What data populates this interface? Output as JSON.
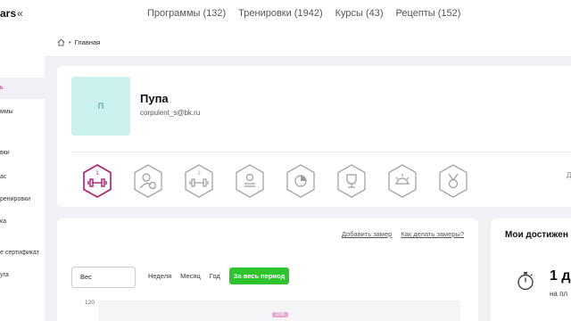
{
  "brand": {
    "logo_text": "ars",
    "collapse_icon": "double-chevron-left-icon"
  },
  "topnav": {
    "items": [
      "Программы (132)",
      "Тренировки (1942)",
      "Курсы (43)",
      "Рецепты (152)"
    ]
  },
  "sidebar": {
    "items": [
      {
        "label": "ь",
        "active": true
      },
      {
        "label": "ммы"
      },
      {
        "label": "вки"
      },
      {
        "label": "ас"
      },
      {
        "label": "ренировки"
      },
      {
        "label": "ка"
      },
      {
        "label": "е сертификат"
      },
      {
        "label": "уга"
      }
    ]
  },
  "breadcrumb": {
    "home_icon": "home-icon",
    "current": "Главная"
  },
  "profile": {
    "avatar_letter": "П",
    "name": "Пупа",
    "email": "corpulent_s@bk.ru",
    "badges": [
      {
        "icon": "dumbbell-icon",
        "number": "1",
        "active": true,
        "color": "#b2186e"
      },
      {
        "icon": "user-clock-icon",
        "active": false
      },
      {
        "icon": "dumbbell-icon",
        "number": "2",
        "active": false
      },
      {
        "icon": "id-card-icon",
        "active": false
      },
      {
        "icon": "pie-chart-icon",
        "active": false
      },
      {
        "icon": "trophy-icon",
        "active": false
      },
      {
        "icon": "sunrise-icon",
        "active": false
      },
      {
        "icon": "medal-icon",
        "active": false
      }
    ],
    "more_label": "Д"
  },
  "measurements": {
    "add_link": "Добавить замер",
    "howto_link": "Как делать замеры?",
    "select_value": "Вес",
    "periods": [
      "Неделя",
      "Месяц",
      "Год",
      "За весь период"
    ],
    "active_period": "За весь период",
    "y_tick": "120",
    "point_label": "106"
  },
  "achievements": {
    "title": "Мои достижен",
    "icon": "stopwatch-icon",
    "value": "1 д",
    "sub": "на пл"
  },
  "colors": {
    "accent": "#b2186e",
    "green": "#2ec42e",
    "avatar_bg": "#c9f1ee",
    "point": "#e9a7d6"
  }
}
